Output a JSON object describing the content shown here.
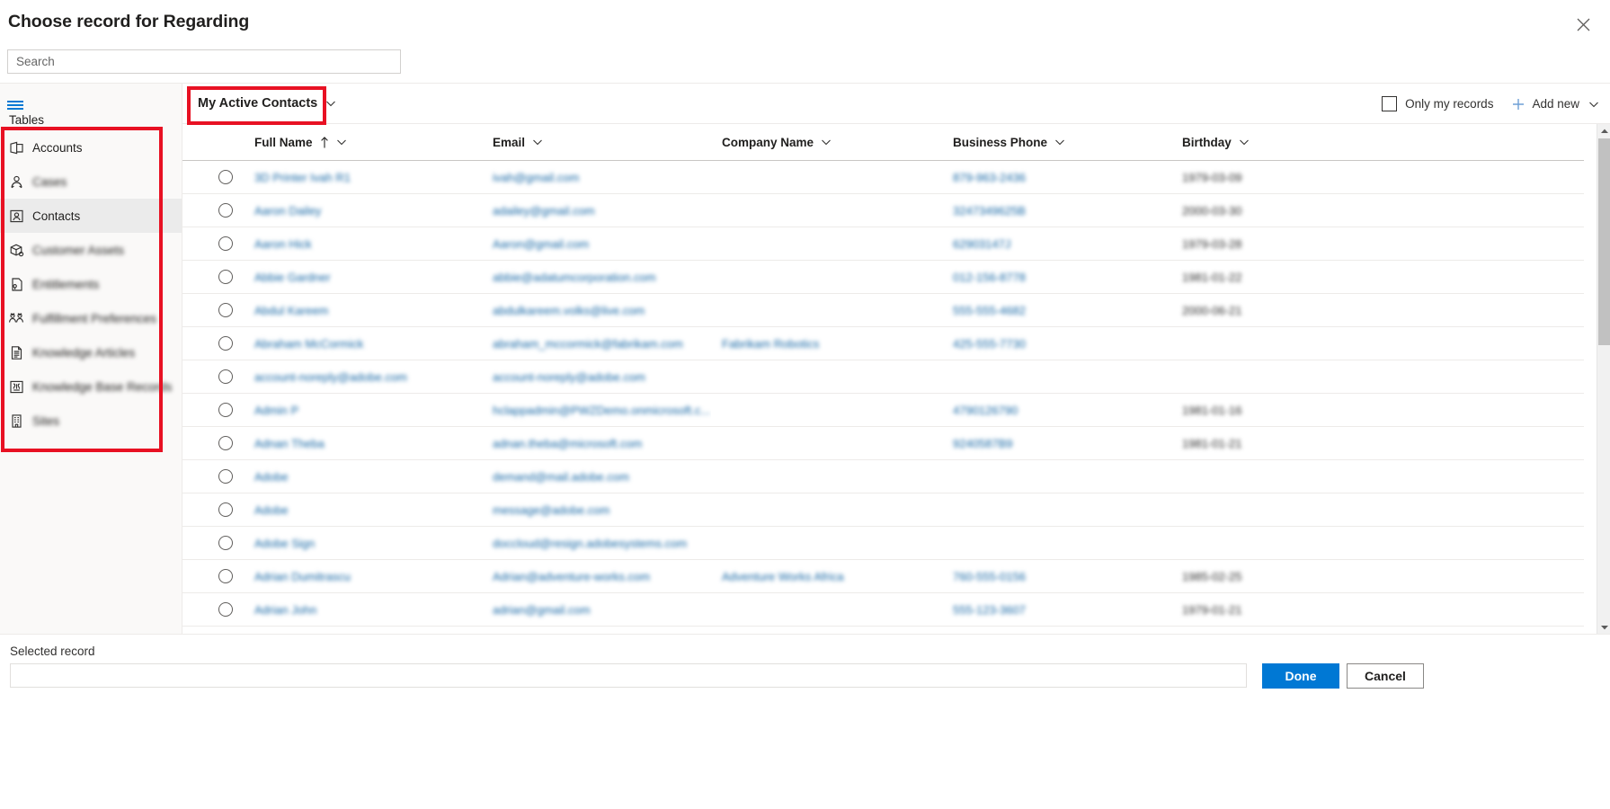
{
  "dialog": {
    "title": "Choose record for Regarding",
    "close_icon": "close-icon"
  },
  "search": {
    "placeholder": "Search",
    "value": ""
  },
  "sidebar": {
    "menu_icon": "hamburger-icon",
    "section_label": "Tables",
    "items": [
      {
        "label": "Accounts",
        "icon": "account-icon",
        "selected": false,
        "blurred": false
      },
      {
        "label": "Cases",
        "icon": "case-icon",
        "selected": false,
        "blurred": true
      },
      {
        "label": "Contacts",
        "icon": "contact-icon",
        "selected": true,
        "blurred": false
      },
      {
        "label": "Customer Assets",
        "icon": "customer-asset-icon",
        "selected": false,
        "blurred": true
      },
      {
        "label": "Entitlements",
        "icon": "entitlement-icon",
        "selected": false,
        "blurred": true
      },
      {
        "label": "Fulfillment Preferences",
        "icon": "fulfillment-pref-icon",
        "selected": false,
        "blurred": true
      },
      {
        "label": "Knowledge Articles",
        "icon": "knowledge-article-icon",
        "selected": false,
        "blurred": true
      },
      {
        "label": "Knowledge Base Records",
        "icon": "knowledge-base-icon",
        "selected": false,
        "blurred": true
      },
      {
        "label": "Sites",
        "icon": "site-icon",
        "selected": false,
        "blurred": true
      }
    ]
  },
  "command_bar": {
    "view_selector_label": "My Active Contacts",
    "view_selector_chevron": "chevron-down-icon",
    "only_my_records_label": "Only my records",
    "only_my_records_checked": false,
    "add_new_label": "Add new",
    "add_new_plus_icon": "plus-icon",
    "add_new_chevron": "chevron-down-icon"
  },
  "table": {
    "columns": [
      {
        "key": "radio",
        "label": "",
        "sorted": false
      },
      {
        "key": "name",
        "label": "Full Name",
        "sorted": true
      },
      {
        "key": "email",
        "label": "Email",
        "sorted": false
      },
      {
        "key": "company",
        "label": "Company Name",
        "sorted": false
      },
      {
        "key": "phone",
        "label": "Business Phone",
        "sorted": false
      },
      {
        "key": "bday",
        "label": "Birthday",
        "sorted": false
      }
    ],
    "sort_direction": "ascending",
    "rows": [
      {
        "name": "3D Printer Ivah R1",
        "email": "ivah@gmail.com",
        "company": "",
        "phone": "879-963-2436",
        "bday": "1979-03-09"
      },
      {
        "name": "Aaron Dailey",
        "email": "adailey@gmail.com",
        "company": "",
        "phone": "3247349625B",
        "bday": "2000-03-30"
      },
      {
        "name": "Aaron Hick",
        "email": "Aaron@gmail.com",
        "company": "",
        "phone": "62903147J",
        "bday": "1979-03-28"
      },
      {
        "name": "Abbie Gardner",
        "email": "abbie@adatumcorporation.com",
        "company": "",
        "phone": "012-156-8778",
        "bday": "1981-01-22"
      },
      {
        "name": "Abdul Kareem",
        "email": "abdulkareem.volks@live.com",
        "company": "",
        "phone": "555-555-4682",
        "bday": "2000-06-21"
      },
      {
        "name": "Abraham McCormick",
        "email": "abraham_mccormick@fabrikam.com",
        "company": "Fabrikam Robotics",
        "phone": "425-555-7730",
        "bday": ""
      },
      {
        "name": "account-noreply@adobe.com",
        "email": "account-noreply@adobe.com",
        "company": "",
        "phone": "",
        "bday": ""
      },
      {
        "name": "Admin P",
        "email": "hclappadmin@PWZDemo.onmicrosoft.c...",
        "company": "",
        "phone": "4790126790",
        "bday": "1981-01-16"
      },
      {
        "name": "Adnan Theba",
        "email": "adnan.theba@microsoft.com",
        "company": "",
        "phone": "9240587B9",
        "bday": "1981-01-21"
      },
      {
        "name": "Adobe",
        "email": "demand@mail.adobe.com",
        "company": "",
        "phone": "",
        "bday": ""
      },
      {
        "name": "Adobe",
        "email": "message@adobe.com",
        "company": "",
        "phone": "",
        "bday": ""
      },
      {
        "name": "Adobe Sign",
        "email": "doccloud@resign.adobesystems.com",
        "company": "",
        "phone": "",
        "bday": ""
      },
      {
        "name": "Adrian Dumitrascu",
        "email": "Adrian@adventure-works.com",
        "company": "Adventure Works Africa",
        "phone": "760-555-0156",
        "bday": "1985-02-25"
      },
      {
        "name": "Adrian John",
        "email": "adrian@gmail.com",
        "company": "",
        "phone": "555-123-3607",
        "bday": "1979-01-21"
      }
    ]
  },
  "footer": {
    "selected_record_label": "Selected record",
    "selected_record_value": "",
    "done_label": "Done",
    "cancel_label": "Cancel"
  },
  "annotations": {
    "highlight_color": "#e81123",
    "boxes": [
      "sidebar-tables-list",
      "view-selector"
    ]
  }
}
